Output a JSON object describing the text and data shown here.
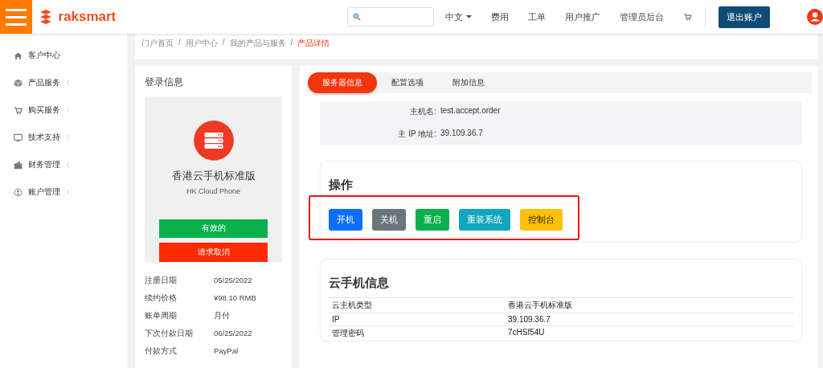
{
  "header": {
    "brand": "raksmart",
    "language": "中文",
    "nav": [
      "费用",
      "工单",
      "用户推广",
      "管理员后台"
    ],
    "logout": "退出账户"
  },
  "sidebar": {
    "items": [
      {
        "label": "客户中心",
        "expandable": false
      },
      {
        "label": "产品服务",
        "expandable": true
      },
      {
        "label": "购买服务",
        "expandable": true
      },
      {
        "label": "技术支持",
        "expandable": true
      },
      {
        "label": "财务管理",
        "expandable": true
      },
      {
        "label": "账户管理",
        "expandable": true
      }
    ]
  },
  "breadcrumb": [
    {
      "label": "门户首页",
      "current": false
    },
    {
      "separator": "/",
      "label": "用户中心",
      "current": false
    },
    {
      "separator": "/",
      "label": "我的产品与服务",
      "current": false
    },
    {
      "separator": "/",
      "label": "产品详情",
      "current": true
    }
  ],
  "login_card": {
    "title": "登录信息",
    "product_name": "香港云手机标准版",
    "product_subtitle": "HK Cloud Phone",
    "status": "有效的",
    "cancel": "请求取消",
    "details": [
      {
        "label": "注册日期",
        "value": "05/25/2022"
      },
      {
        "label": "续约价格",
        "value": "¥98.10 RMB"
      },
      {
        "label": "账单周期",
        "value": "月付"
      },
      {
        "label": "下次付款日期",
        "value": "06/25/2022"
      },
      {
        "label": "付款方式",
        "value": "PayPal"
      }
    ]
  },
  "tabs": [
    {
      "label": "服务器信息",
      "selected": true
    },
    {
      "label": "配置选项",
      "selected": false
    },
    {
      "label": "附加信息",
      "selected": false
    }
  ],
  "server_info": [
    {
      "label": "主机名:",
      "value": "test.accept.order"
    },
    {
      "label": "主 IP 地址:",
      "value": "39.109.36.7"
    }
  ],
  "operations": {
    "title": "操作",
    "buttons": [
      {
        "label": "开机",
        "color": "#0d6efd"
      },
      {
        "label": "关机",
        "color": "#6c757d"
      },
      {
        "label": "重启",
        "color": "#0ab04c"
      },
      {
        "label": "重装系统",
        "color": "#11a6bf"
      },
      {
        "label": "控制台",
        "color": "#ffc107"
      }
    ]
  },
  "phone_info": {
    "title": "云手机信息",
    "rows": [
      {
        "label": "云主机类型",
        "value": "香港云手机标准版"
      },
      {
        "label": "IP",
        "value": "39.109.36.7"
      },
      {
        "label": "管理密码",
        "value": "7cHSf54U"
      }
    ]
  }
}
